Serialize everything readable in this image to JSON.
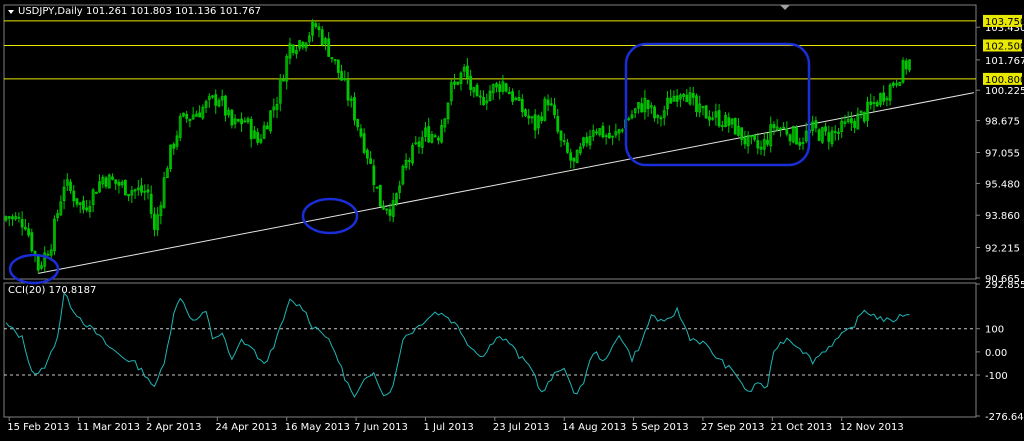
{
  "colors": {
    "background": "#000000",
    "grid": "#808080",
    "candle": "#00c800",
    "trendline": "#e6e6e6",
    "level": "#e8e800",
    "annotation": "#1a2ed8",
    "cci": "#1fb5b5",
    "text": "#ffffff"
  },
  "main_legend": {
    "symbol": "USDJPY,Daily",
    "ohlc": "101.261 101.803 101.136 101.767"
  },
  "cci_legend": "CCI(20) 170.8187",
  "chart_data": [
    {
      "type": "candlestick",
      "title": "USDJPY,Daily",
      "xlabel": "",
      "ylabel": "",
      "ylim": [
        90.665,
        104.51
      ],
      "y_ticks": [
        "103.430",
        "101.767",
        "100.225",
        "98.675",
        "97.055",
        "95.480",
        "93.860",
        "92.215",
        "90.665"
      ],
      "x_ticks": [
        "15 Feb 2013",
        "11 Mar 2013",
        "2 Apr 2013",
        "24 Apr 2013",
        "16 May 2013",
        "7 Jun 2013",
        "1 Jul 2013",
        "23 Jul 2013",
        "14 Aug 2013",
        "5 Sep 2013",
        "27 Sep 2013",
        "21 Oct 2013",
        "12 Nov 2013"
      ],
      "close_path": [
        [
          0,
          93.8
        ],
        [
          6,
          93.5
        ],
        [
          10,
          91.2
        ],
        [
          14,
          92.5
        ],
        [
          18,
          95.5
        ],
        [
          24,
          94.2
        ],
        [
          30,
          95.8
        ],
        [
          38,
          95.2
        ],
        [
          44,
          95.0
        ],
        [
          46,
          93.0
        ],
        [
          50,
          96.5
        ],
        [
          54,
          98.6
        ],
        [
          60,
          99.2
        ],
        [
          66,
          99.9
        ],
        [
          70,
          98.4
        ],
        [
          74,
          98.7
        ],
        [
          78,
          97.6
        ],
        [
          84,
          99.8
        ],
        [
          88,
          102.5
        ],
        [
          92,
          102.8
        ],
        [
          96,
          103.5
        ],
        [
          100,
          102.3
        ],
        [
          104,
          100.8
        ],
        [
          108,
          99.0
        ],
        [
          112,
          97.0
        ],
        [
          116,
          94.5
        ],
        [
          120,
          94.2
        ],
        [
          124,
          96.5
        ],
        [
          130,
          98.0
        ],
        [
          134,
          98.0
        ],
        [
          138,
          100.3
        ],
        [
          142,
          101.2
        ],
        [
          146,
          99.5
        ],
        [
          150,
          100.2
        ],
        [
          154,
          100.6
        ],
        [
          160,
          99.2
        ],
        [
          164,
          98.4
        ],
        [
          168,
          99.8
        ],
        [
          172,
          97.5
        ],
        [
          176,
          96.4
        ],
        [
          182,
          98.4
        ],
        [
          188,
          97.7
        ],
        [
          192,
          98.7
        ],
        [
          198,
          99.6
        ],
        [
          202,
          98.6
        ],
        [
          206,
          99.8
        ],
        [
          210,
          100.4
        ],
        [
          214,
          99.1
        ],
        [
          218,
          99.0
        ],
        [
          222,
          98.7
        ],
        [
          226,
          98.3
        ],
        [
          230,
          97.5
        ],
        [
          234,
          97.2
        ],
        [
          238,
          98.4
        ],
        [
          242,
          98.2
        ],
        [
          246,
          97.7
        ],
        [
          250,
          98.2
        ],
        [
          254,
          97.9
        ],
        [
          258,
          98.1
        ],
        [
          262,
          98.6
        ],
        [
          266,
          99.0
        ],
        [
          270,
          99.7
        ],
        [
          274,
          100.4
        ],
        [
          278,
          101.3
        ],
        [
          280,
          101.77
        ]
      ],
      "high_price": 103.75,
      "high_index": 96,
      "low_price": 90.9,
      "low_index": 10,
      "trendline": [
        [
          10,
          90.9
        ],
        [
          300,
          100.1
        ]
      ],
      "horizontal_levels": [
        {
          "label": "103.750",
          "value": 103.75
        },
        {
          "label": "102.500",
          "value": 102.5
        },
        {
          "label": "100.800",
          "value": 100.8
        }
      ],
      "current_price": "101.767"
    },
    {
      "type": "line",
      "title": "CCI(20) 170.8187",
      "ylim": [
        -276.6462,
        292.8552
      ],
      "y_ticks": [
        "292.8552",
        "100",
        "0.00",
        "-100",
        "-276.6462"
      ],
      "levels": [
        100,
        -100
      ],
      "series": [
        {
          "values": [
            [
              0,
              120
            ],
            [
              5,
              60
            ],
            [
              8,
              -80
            ],
            [
              10,
              -100
            ],
            [
              13,
              -40
            ],
            [
              16,
              70
            ],
            [
              18,
              250
            ],
            [
              21,
              180
            ],
            [
              24,
              130
            ],
            [
              28,
              80
            ],
            [
              32,
              20
            ],
            [
              36,
              -20
            ],
            [
              40,
              -50
            ],
            [
              44,
              -110
            ],
            [
              46,
              -160
            ],
            [
              49,
              -40
            ],
            [
              52,
              160
            ],
            [
              54,
              240
            ],
            [
              58,
              130
            ],
            [
              62,
              170
            ],
            [
              64,
              60
            ],
            [
              67,
              80
            ],
            [
              70,
              -40
            ],
            [
              73,
              50
            ],
            [
              76,
              20
            ],
            [
              80,
              -60
            ],
            [
              84,
              60
            ],
            [
              88,
              220
            ],
            [
              92,
              190
            ],
            [
              95,
              110
            ],
            [
              98,
              90
            ],
            [
              102,
              0
            ],
            [
              105,
              -110
            ],
            [
              108,
              -200
            ],
            [
              111,
              -130
            ],
            [
              114,
              -80
            ],
            [
              117,
              -190
            ],
            [
              120,
              -150
            ],
            [
              123,
              60
            ],
            [
              127,
              100
            ],
            [
              130,
              140
            ],
            [
              133,
              170
            ],
            [
              136,
              160
            ],
            [
              140,
              110
            ],
            [
              144,
              20
            ],
            [
              148,
              -20
            ],
            [
              152,
              70
            ],
            [
              156,
              40
            ],
            [
              159,
              -20
            ],
            [
              163,
              -70
            ],
            [
              166,
              -180
            ],
            [
              170,
              -100
            ],
            [
              173,
              -60
            ],
            [
              176,
              -190
            ],
            [
              179,
              -130
            ],
            [
              182,
              0
            ],
            [
              186,
              -40
            ],
            [
              190,
              80
            ],
            [
              194,
              -30
            ],
            [
              197,
              40
            ],
            [
              200,
              160
            ],
            [
              204,
              120
            ],
            [
              208,
              180
            ],
            [
              212,
              60
            ],
            [
              216,
              40
            ],
            [
              220,
              -20
            ],
            [
              224,
              -70
            ],
            [
              227,
              -110
            ],
            [
              230,
              -180
            ],
            [
              233,
              -130
            ],
            [
              236,
              -160
            ],
            [
              238,
              10
            ],
            [
              242,
              60
            ],
            [
              246,
              20
            ],
            [
              250,
              -40
            ],
            [
              254,
              10
            ],
            [
              258,
              60
            ],
            [
              262,
              100
            ],
            [
              266,
              180
            ],
            [
              270,
              150
            ],
            [
              274,
              130
            ],
            [
              278,
              160
            ],
            [
              280,
              170
            ]
          ]
        }
      ]
    }
  ]
}
